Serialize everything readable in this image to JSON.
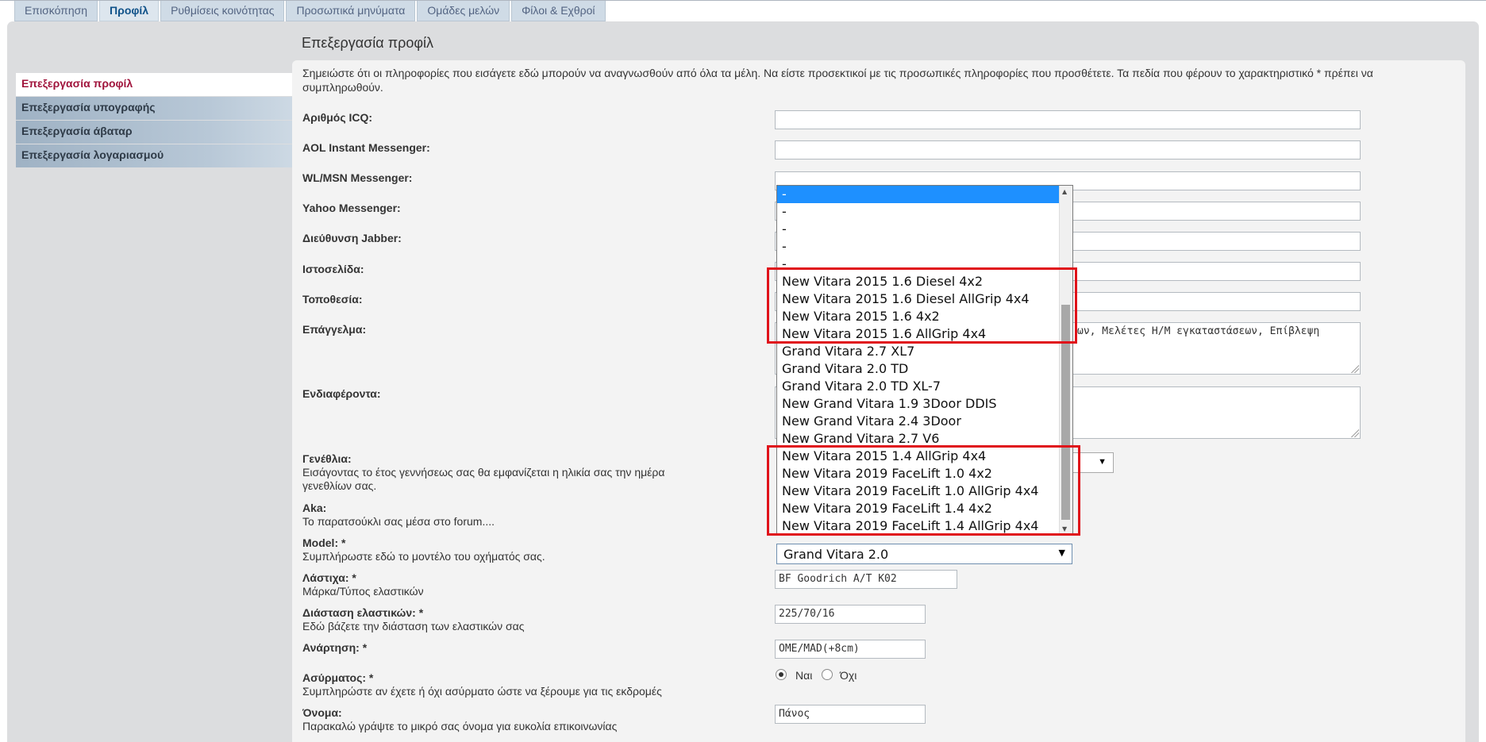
{
  "tabs": [
    {
      "label": "Επισκόπηση",
      "active": false
    },
    {
      "label": "Προφίλ",
      "active": true
    },
    {
      "label": "Ρυθμίσεις κοινότητας",
      "active": false
    },
    {
      "label": "Προσωπικά μηνύματα",
      "active": false
    },
    {
      "label": "Ομάδες μελών",
      "active": false
    },
    {
      "label": "Φίλοι & Εχθροί",
      "active": false
    }
  ],
  "page_title": "Επεξεργασία προφίλ",
  "sidebar": {
    "items": [
      {
        "label": "Επεξεργασία προφίλ",
        "active": true
      },
      {
        "label": "Επεξεργασία υπογραφής",
        "active": false
      },
      {
        "label": "Επεξεργασία άβαταρ",
        "active": false
      },
      {
        "label": "Επεξεργασία λογαριασμού",
        "active": false
      }
    ]
  },
  "notice": "Σημειώστε ότι οι πληροφορίες που εισάγετε εδώ μπορούν να αναγνωσθούν από όλα τα μέλη. Να είστε προσεκτικοί με τις προσωπικές πληροφορίες που προσθέτετε. Τα πεδία που φέρουν το χαρακτηριστικό * πρέπει να συμπληρωθούν.",
  "fields": {
    "icq": {
      "label": "Αριθμός ICQ:",
      "value": ""
    },
    "aol": {
      "label": "AOL Instant Messenger:",
      "value": ""
    },
    "msn": {
      "label": "WL/MSN Messenger:",
      "value": ""
    },
    "yahoo": {
      "label": "Yahoo Messenger:",
      "value": ""
    },
    "jabber": {
      "label": "Διεύθυνση Jabber:",
      "value": ""
    },
    "website": {
      "label": "Ιστοσελίδα:",
      "value": ""
    },
    "location": {
      "label": "Τοποθεσία:",
      "value": ""
    },
    "occupation": {
      "label": "Επάγγελμα:",
      "value": "ων, Μελέτες Η/Μ εγκαταστάσεων, Επίβλεψη"
    },
    "interests": {
      "label": "Ενδιαφέροντα:",
      "value": ""
    },
    "birthday": {
      "label": "Γενέθλια:",
      "hint": "Εισάγοντας το έτος γεννήσεως σας θα εμφανίζεται η ηλικία σας την ημέρα γενεθλίων σας."
    },
    "aka": {
      "label": "Aka:",
      "hint": "Το παρατσούκλι σας μέσα στο forum...."
    },
    "model": {
      "label": "Model: *",
      "hint": "Συμπλήρωστε εδώ το μοντέλο του οχήματός σας.",
      "value": "Grand Vitara 2.0"
    },
    "tyres": {
      "label": "Λάστιχα: *",
      "hint": "Μάρκα/Τύπος ελαστικών",
      "value": "BF Goodrich A/T K02"
    },
    "tyre_size": {
      "label": "Διάσταση ελαστικών: *",
      "hint": "Εδώ βάζετε την διάσταση των ελαστικών σας",
      "value": "225/70/16"
    },
    "suspension": {
      "label": "Ανάρτηση: *",
      "value": "OME/MAD(+8cm)"
    },
    "radio": {
      "label": "Ασύρματος: *",
      "hint": "Συμπληρώστε αν έχετε ή όχι ασύρματο ώστε να ξέρουμε για τις εκδρομές",
      "yes": "Ναι",
      "no": "Όχι",
      "selected": "yes"
    },
    "name": {
      "label": "Όνομα:",
      "hint": "Παρακαλώ γράψτε το μικρό σας όνομα για ευκολία επικοινωνίας",
      "value": "Πάνος"
    }
  },
  "dropdown": {
    "options": [
      "-",
      "-",
      "-",
      "-",
      "-",
      "New Vitara 2015 1.6 Diesel 4x2",
      "New Vitara 2015 1.6 Diesel AllGrip 4x4",
      "New Vitara 2015 1.6 4x2",
      "New Vitara 2015 1.6 AllGrip 4x4",
      "Grand Vitara 2.7 XL7",
      "Grand Vitara 2.0 TD",
      "Grand Vitara 2.0 TD XL-7",
      "New Grand Vitara 1.9 3Door DDIS",
      "New Grand Vitara 2.4 3Door",
      "New Grand Vitara 2.7 V6",
      "New Vitara 2015 1.4 AllGrip 4x4",
      "New Vitara 2019 FaceLift 1.0 4x2",
      "New Vitara 2019 FaceLift 1.0 AllGrip 4x4",
      "New Vitara 2019 FaceLift 1.4 4x2",
      "New Vitara 2019 FaceLift 1.4 AllGrip 4x4"
    ],
    "highlighted_index": 0
  },
  "colors": {
    "highlight_box": "#e0121a",
    "selected_option": "#1e90ff",
    "active_sidebar": "#a0143c"
  }
}
